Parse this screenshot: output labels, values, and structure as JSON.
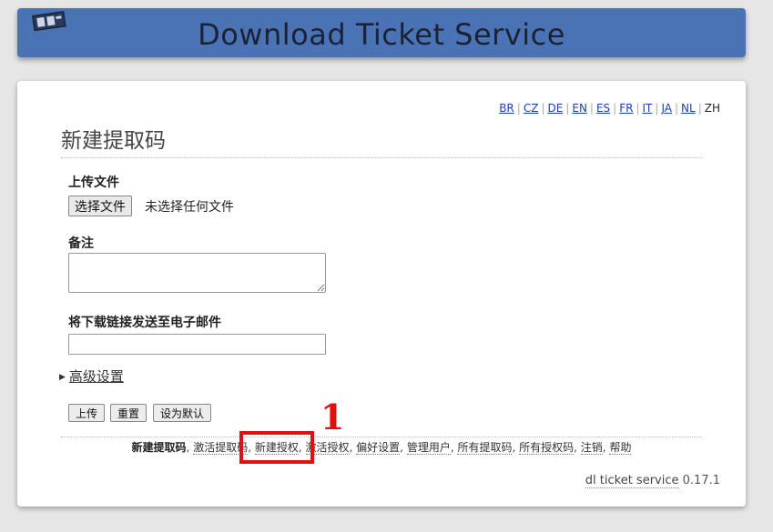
{
  "header": {
    "title": "Download Ticket Service"
  },
  "languages": {
    "items": [
      "BR",
      "CZ",
      "DE",
      "EN",
      "ES",
      "FR",
      "IT",
      "JA",
      "NL"
    ],
    "current": "ZH"
  },
  "form": {
    "page_title": "新建提取码",
    "upload_label": "上传文件",
    "choose_file_button": "选择文件",
    "file_status": "未选择任何文件",
    "comment_label": "备注",
    "comment_value": "",
    "email_label": "将下载链接发送至电子邮件",
    "email_value": "",
    "advanced_label": "高级设置",
    "upload_button": "上传",
    "reset_button": "重置",
    "set_default_button": "设为默认"
  },
  "nav": {
    "current": "新建提取码",
    "links": [
      "激活提取码",
      "新建授权",
      "激活授权",
      "偏好设置",
      "管理用户",
      "所有提取码",
      "所有授权码",
      "注销",
      "帮助"
    ]
  },
  "footer": {
    "link": "dl ticket service",
    "version": "0.17.1"
  },
  "annotation": {
    "number": "1",
    "color": "#e01010"
  },
  "colors": {
    "header_bg": "#4a73b5",
    "page_bg": "#e6e6e6",
    "link": "#1b3fb8"
  }
}
